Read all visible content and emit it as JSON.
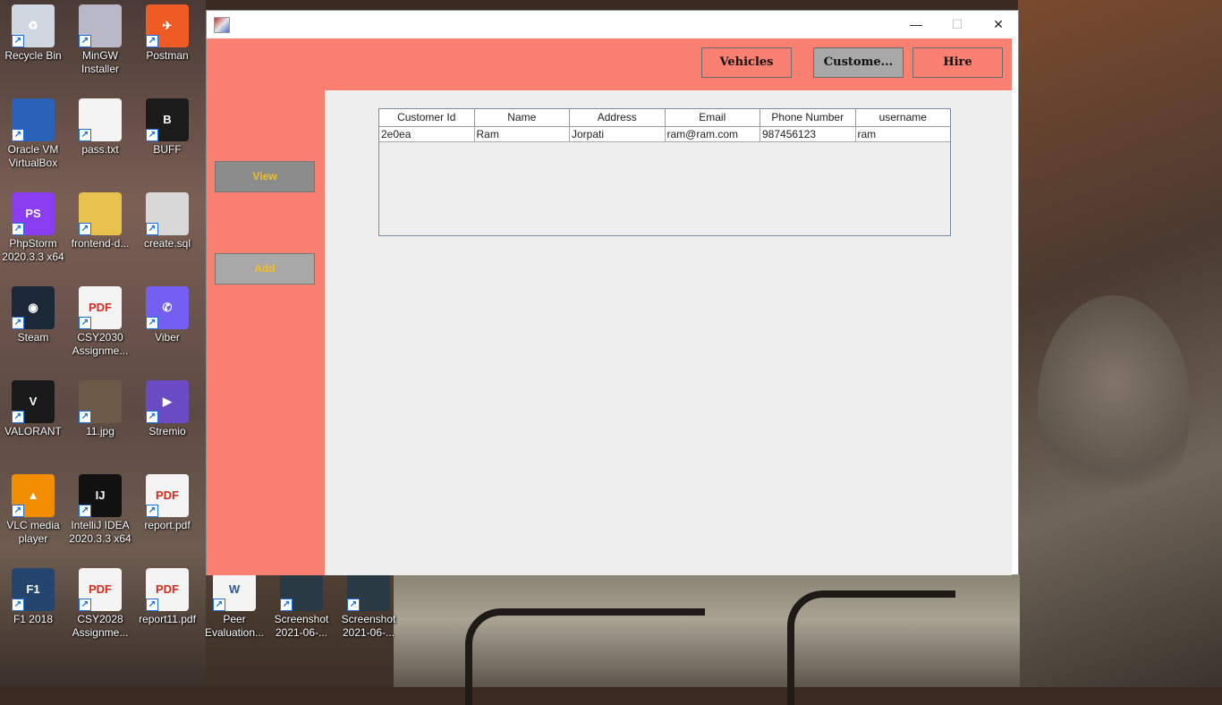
{
  "desktop": {
    "icons": [
      {
        "label": "Recycle Bin",
        "icon": "recycle-bin-icon"
      },
      {
        "label": "MinGW Installer",
        "icon": "installer-icon"
      },
      {
        "label": "Postman",
        "icon": "postman-icon"
      },
      {
        "label": "Oracle VM VirtualBox",
        "icon": "virtualbox-icon"
      },
      {
        "label": "pass.txt",
        "icon": "text-file-icon"
      },
      {
        "label": "BUFF",
        "icon": "buff-icon"
      },
      {
        "label": "PhpStorm 2020.3.3 x64",
        "icon": "phpstorm-icon"
      },
      {
        "label": "frontend-d...",
        "icon": "folder-icon"
      },
      {
        "label": "create.sql",
        "icon": "sql-file-icon"
      },
      {
        "label": "Steam",
        "icon": "steam-icon"
      },
      {
        "label": "CSY2030 Assignme...",
        "icon": "pdf-icon"
      },
      {
        "label": "Viber",
        "icon": "viber-icon"
      },
      {
        "label": "VALORANT",
        "icon": "valorant-icon"
      },
      {
        "label": "11.jpg",
        "icon": "image-file-icon"
      },
      {
        "label": "Stremio",
        "icon": "stremio-icon"
      },
      {
        "label": "VLC media player",
        "icon": "vlc-icon"
      },
      {
        "label": "IntelliJ IDEA 2020.3.3 x64",
        "icon": "intellij-icon"
      },
      {
        "label": "report.pdf",
        "icon": "pdf-icon"
      },
      {
        "label": "F1 2018",
        "icon": "f1-game-icon"
      },
      {
        "label": "CSY2028 Assignme...",
        "icon": "pdf-icon"
      },
      {
        "label": "report11.pdf",
        "icon": "pdf-icon"
      },
      {
        "label": "Peer Evaluation...",
        "icon": "word-doc-icon"
      },
      {
        "label": "Screenshot 2021-06-...",
        "icon": "screenshot-file-icon"
      },
      {
        "label": "Screenshot 2021-06-...",
        "icon": "screenshot-file-icon"
      }
    ]
  },
  "window": {
    "controls": {
      "minimize": "—",
      "maximize": "☐",
      "close": "✕"
    },
    "nav": {
      "vehicles": "Vehicles",
      "customers": "Custome...",
      "hire": "Hire"
    },
    "sidebar": {
      "view": "View",
      "add": "Add"
    },
    "table": {
      "columns": [
        "Customer Id",
        "Name",
        "Address",
        "Email",
        "Phone Number",
        "username"
      ],
      "rows": [
        [
          "2e0ea",
          "Ram",
          "Jorpati",
          "ram@ram.com",
          "987456123",
          "ram"
        ]
      ]
    }
  },
  "colors": {
    "panel": "#fa8072",
    "button_gray": "#8c8c8c",
    "button_label": "#f0c020",
    "nav_active": "#a8a8a8"
  }
}
